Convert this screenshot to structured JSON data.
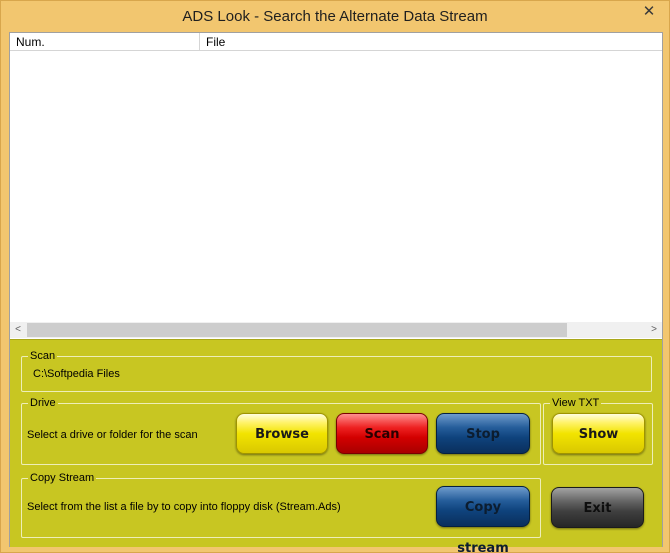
{
  "window": {
    "title": "ADS Look - Search the Alternate Data Stream",
    "close_glyph": "✕"
  },
  "list": {
    "columns": [
      "Num.",
      "File"
    ],
    "rows": [],
    "scroll_left_glyph": "<",
    "scroll_right_glyph": ">"
  },
  "scan_group": {
    "label": "Scan",
    "path": "C:\\Softpedia Files"
  },
  "drive_group": {
    "label": "Drive",
    "hint": "Select a drive or folder for the scan",
    "browse_label": "Browse",
    "scan_label": "Scan",
    "stop_label": "Stop"
  },
  "view_group": {
    "label": "View TXT",
    "show_label": "Show"
  },
  "copy_group": {
    "label": "Copy Stream",
    "hint": "Select from the list a file by to copy into floppy disk (Stream.Ads)",
    "copy_label": "Copy stream"
  },
  "exit_label": "Exit",
  "colors": {
    "titlebar": "#f2c66f",
    "panel": "#c8c622",
    "yellow_button": "#f2e400",
    "red_button": "#d30000",
    "blue_button": "#0f437d",
    "gray_button": "#3f3f3f"
  }
}
